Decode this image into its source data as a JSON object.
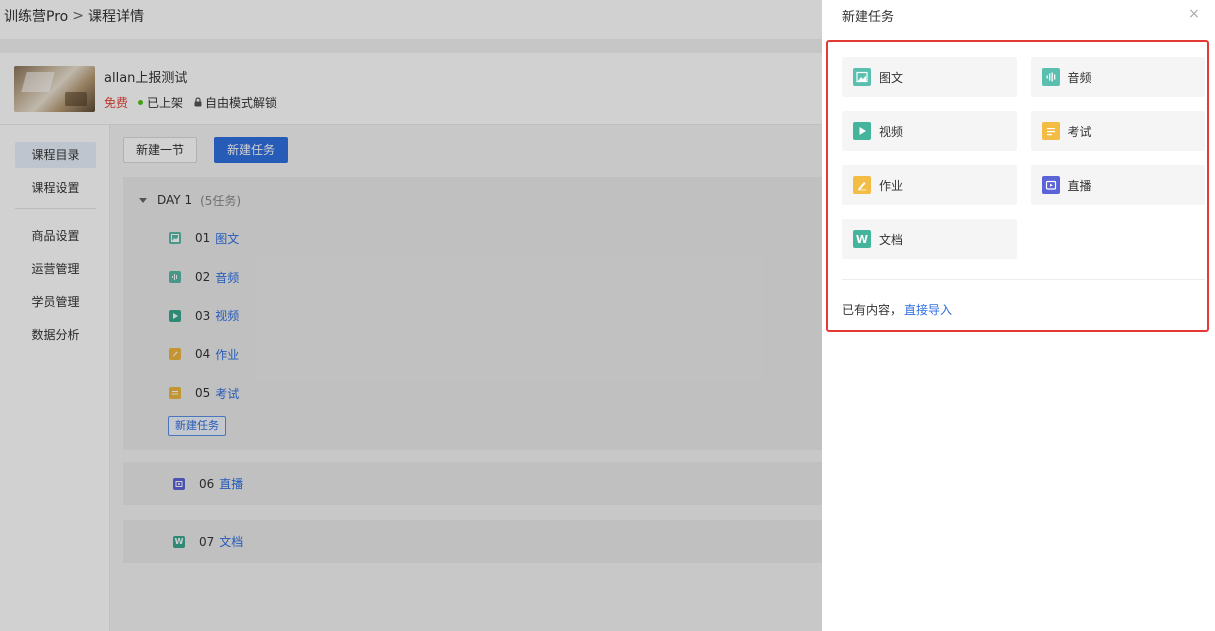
{
  "breadcrumb": {
    "app": "训练营Pro",
    "separator": ">",
    "page": "课程详情"
  },
  "course": {
    "name": "allan上报测试",
    "price": "免费",
    "status": "已上架",
    "unlock_mode": "自由模式解锁"
  },
  "leftnav": {
    "group1": [
      {
        "label": "课程目录",
        "active": true
      },
      {
        "label": "课程设置",
        "active": false
      }
    ],
    "group2": [
      {
        "label": "商品设置"
      },
      {
        "label": "运营管理"
      },
      {
        "label": "学员管理"
      },
      {
        "label": "数据分析"
      }
    ]
  },
  "toolbar": {
    "new_section": "新建一节",
    "new_task": "新建任务"
  },
  "day": {
    "title": "DAY 1",
    "count": "(5任务)",
    "tasks": [
      {
        "num": "01",
        "name": "图文",
        "color": "#59b9a6"
      },
      {
        "num": "02",
        "name": "音频",
        "color": "#59b9a6"
      },
      {
        "num": "03",
        "name": "视频",
        "color": "#3aa88f"
      },
      {
        "num": "04",
        "name": "作业",
        "color": "#f0b63f"
      },
      {
        "num": "05",
        "name": "考试",
        "color": "#f0b63f"
      }
    ],
    "add_task": "新建任务"
  },
  "solo_tasks": [
    {
      "num": "06",
      "name": "直播",
      "color": "#5a63d8"
    },
    {
      "num": "07",
      "name": "文档",
      "color": "#3aa88f"
    }
  ],
  "drawer": {
    "title": "新建任务",
    "close": "×",
    "types": [
      {
        "label": "图文",
        "icon": "image-icon",
        "color": "#5bbfb0"
      },
      {
        "label": "音频",
        "icon": "audio-icon",
        "color": "#5bbfb0"
      },
      {
        "label": "视频",
        "icon": "video-icon",
        "color": "#45b49c"
      },
      {
        "label": "考试",
        "icon": "exam-icon",
        "color": "#f3bd45"
      },
      {
        "label": "作业",
        "icon": "homework-icon",
        "color": "#f3bd45"
      },
      {
        "label": "直播",
        "icon": "live-icon",
        "color": "#5a63d8"
      },
      {
        "label": "文档",
        "icon": "document-icon",
        "color": "#45b49c",
        "glyph": "W"
      }
    ],
    "import_prefix": "已有内容，",
    "import_link": "直接导入"
  },
  "colors": {
    "primary": "#2f6fe0",
    "highlight": "#e53935",
    "free": "#e5463b",
    "online": "#52c41a"
  }
}
